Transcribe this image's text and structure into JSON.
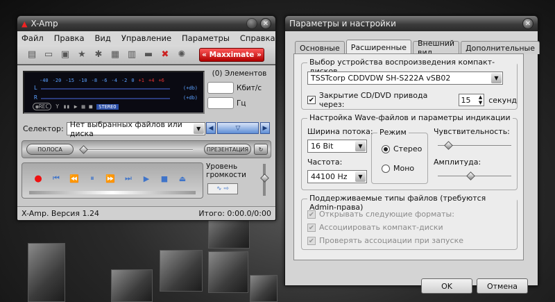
{
  "xamp": {
    "title": "X-Amp",
    "menu": [
      "Файл",
      "Правка",
      "Вид",
      "Управление",
      "Параметры",
      "Справка"
    ],
    "toolbar_icons": [
      "document-icon",
      "folder-icon",
      "save-icon",
      "star-icon",
      "gear-icon",
      "notes-icon",
      "print-icon",
      "card-icon",
      "tools-icon",
      "sun-icon"
    ],
    "maxximate_label": "Maxximate",
    "vu": {
      "scale": [
        "-40",
        "-20",
        "-15",
        "-10",
        "-8",
        "-6",
        "-4",
        "-2",
        "0",
        "+1",
        "+4",
        "+6"
      ],
      "left": "L",
      "right": "R",
      "db": "(+db)",
      "rec": "REC",
      "stereo": "STEREO"
    },
    "elements_label": "(0) Элементов",
    "kbps_label": "Кбит/с",
    "hz_label": "Гц",
    "selector_label": "Селектор:",
    "selector_value": "Нет выбранных файлов или диска",
    "polosa_label": "ПОЛОСА",
    "presentation_label": "ПРЕЗЕНТАЦИЯ",
    "volume_label_1": "Уровень",
    "volume_label_2": "громкости",
    "version": "X-Amp. Версия 1.24",
    "total": "Итого:  0:00.0/0:00"
  },
  "settings": {
    "title": "Параметры и настройки",
    "tabs": [
      "Основные",
      "Расширенные",
      "Внешний вид",
      "Дополнительные"
    ],
    "active_tab": "Расширенные",
    "cd_group": {
      "label": "Выбор устройства воспроизведения компакт-дисков",
      "device": "TSSTcorp CDDVDW SH-S222A vSB02",
      "close_tray_label": "Закрытие CD/DVD привода через:",
      "close_tray_checked": true,
      "close_tray_value": "15",
      "seconds_label": "секунд"
    },
    "wave_group": {
      "label": "Настройка Wave-файлов и параметры индикации",
      "width_label": "Ширина потока:",
      "width_value": "16 Bit",
      "freq_label": "Частота:",
      "freq_value": "44100 Hz",
      "mode_label": "Режим",
      "stereo_label": "Стерео",
      "mono_label": "Моно",
      "selected_mode": "Стерео",
      "sensitivity_label": "Чувствительность:",
      "sensitivity_level": 0.15,
      "amplitude_label": "Амплитуда:",
      "amplitude_level": 0.45
    },
    "types_group": {
      "label": "Поддерживаемые типы файлов (требуются Admin-права)",
      "options": [
        "Открывать следующие форматы:",
        "Ассоциировать компакт-диски",
        "Проверять ассоциации при запуске"
      ]
    },
    "ok_label": "OK",
    "cancel_label": "Отмена"
  }
}
